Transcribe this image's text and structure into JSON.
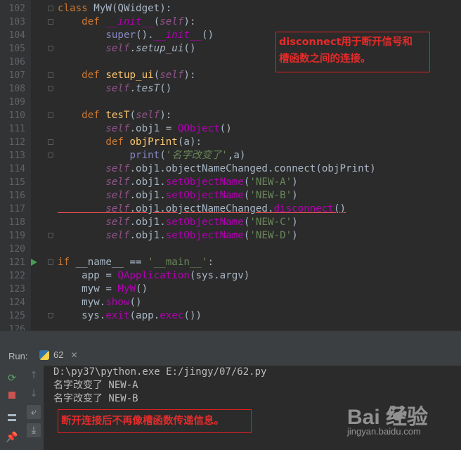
{
  "editor": {
    "lines": [
      {
        "n": "102",
        "tokens": [
          [
            "kw",
            "class "
          ],
          [
            "cls",
            "MyW"
          ],
          [
            "",
            "("
          ],
          [
            "cls",
            "QWidget"
          ],
          [
            "",
            "):"
          ]
        ]
      },
      {
        "n": "103",
        "tokens": [
          [
            "",
            "    "
          ],
          [
            "kw",
            "def "
          ],
          [
            "dund",
            "__init__"
          ],
          [
            "",
            "("
          ],
          [
            "self",
            "self"
          ],
          [
            "",
            "):"
          ]
        ]
      },
      {
        "n": "104",
        "tokens": [
          [
            "",
            "        "
          ],
          [
            "builtin",
            "super"
          ],
          [
            "",
            "()."
          ],
          [
            "dund",
            "__init__"
          ],
          [
            "",
            "()"
          ]
        ]
      },
      {
        "n": "105",
        "tokens": [
          [
            "",
            "        "
          ],
          [
            "self",
            "self"
          ],
          [
            "",
            "."
          ],
          [
            "it",
            "setup_ui"
          ],
          [
            "",
            "()"
          ]
        ]
      },
      {
        "n": "106",
        "tokens": []
      },
      {
        "n": "107",
        "tokens": [
          [
            "",
            "    "
          ],
          [
            "kw",
            "def "
          ],
          [
            "fn",
            "setup_ui"
          ],
          [
            "",
            "("
          ],
          [
            "self",
            "self"
          ],
          [
            "",
            "):"
          ]
        ]
      },
      {
        "n": "108",
        "tokens": [
          [
            "",
            "        "
          ],
          [
            "self",
            "self"
          ],
          [
            "",
            "."
          ],
          [
            "it",
            "tesT"
          ],
          [
            "",
            "()"
          ]
        ]
      },
      {
        "n": "109",
        "tokens": []
      },
      {
        "n": "110",
        "tokens": [
          [
            "",
            "    "
          ],
          [
            "kw",
            "def "
          ],
          [
            "fn",
            "tesT"
          ],
          [
            "",
            "("
          ],
          [
            "self",
            "self"
          ],
          [
            "",
            "):"
          ]
        ]
      },
      {
        "n": "111",
        "tokens": [
          [
            "",
            "        "
          ],
          [
            "self",
            "self"
          ],
          [
            "",
            ".obj1 = "
          ],
          [
            "mag",
            "QObject"
          ],
          [
            "",
            "()"
          ]
        ]
      },
      {
        "n": "112",
        "tokens": [
          [
            "",
            "        "
          ],
          [
            "kw",
            "def "
          ],
          [
            "fn",
            "objPrint"
          ],
          [
            "",
            "(a):"
          ]
        ]
      },
      {
        "n": "113",
        "tokens": [
          [
            "",
            "            "
          ],
          [
            "builtin",
            "print"
          ],
          [
            "",
            "("
          ],
          [
            "strI",
            "'名字改变了'"
          ],
          [
            "",
            ",a)"
          ]
        ]
      },
      {
        "n": "114",
        "tokens": [
          [
            "",
            "        "
          ],
          [
            "self",
            "self"
          ],
          [
            "",
            ".obj1.objectNameChanged."
          ],
          [
            "meth",
            "connect"
          ],
          [
            "",
            "(objPrint)"
          ]
        ]
      },
      {
        "n": "115",
        "tokens": [
          [
            "",
            "        "
          ],
          [
            "self",
            "self"
          ],
          [
            "",
            ".obj1."
          ],
          [
            "mag",
            "setObjectName"
          ],
          [
            "",
            "("
          ],
          [
            "str",
            "'NEW-A'"
          ],
          [
            "",
            ")"
          ]
        ]
      },
      {
        "n": "116",
        "tokens": [
          [
            "",
            "        "
          ],
          [
            "self",
            "self"
          ],
          [
            "",
            ".obj1."
          ],
          [
            "mag",
            "setObjectName"
          ],
          [
            "",
            "("
          ],
          [
            "str",
            "'NEW-B'"
          ],
          [
            "",
            ")"
          ]
        ]
      },
      {
        "n": "117",
        "tokens": [
          [
            "",
            "        "
          ],
          [
            "self",
            "self"
          ],
          [
            "",
            ".obj1.objectNameChanged."
          ],
          [
            "mag",
            "disconnect"
          ],
          [
            "",
            "()"
          ]
        ]
      },
      {
        "n": "118",
        "tokens": [
          [
            "",
            "        "
          ],
          [
            "self",
            "self"
          ],
          [
            "",
            ".obj1."
          ],
          [
            "mag",
            "setObjectName"
          ],
          [
            "",
            "("
          ],
          [
            "str",
            "'NEW-C'"
          ],
          [
            "",
            ")"
          ]
        ]
      },
      {
        "n": "119",
        "tokens": [
          [
            "",
            "        "
          ],
          [
            "self",
            "self"
          ],
          [
            "",
            ".obj1."
          ],
          [
            "mag",
            "setObjectName"
          ],
          [
            "",
            "("
          ],
          [
            "str",
            "'NEW-D'"
          ],
          [
            "",
            ")"
          ]
        ]
      },
      {
        "n": "120",
        "tokens": []
      },
      {
        "n": "121",
        "tokens": [
          [
            "kw",
            "if "
          ],
          [
            "",
            "__name__ == "
          ],
          [
            "str",
            "'__main__'"
          ],
          [
            "",
            ":"
          ]
        ]
      },
      {
        "n": "122",
        "tokens": [
          [
            "",
            "    app = "
          ],
          [
            "mag",
            "QApplication"
          ],
          [
            "",
            "(sys.argv)"
          ]
        ]
      },
      {
        "n": "123",
        "tokens": [
          [
            "",
            "    myw = "
          ],
          [
            "mag",
            "MyW"
          ],
          [
            "",
            "()"
          ]
        ]
      },
      {
        "n": "124",
        "tokens": [
          [
            "",
            "    myw."
          ],
          [
            "mag",
            "show"
          ],
          [
            "",
            "()"
          ]
        ]
      },
      {
        "n": "125",
        "tokens": [
          [
            "",
            "    sys."
          ],
          [
            "mag",
            "exit"
          ],
          [
            "",
            "(app."
          ],
          [
            "mag",
            "exec"
          ],
          [
            "",
            "())"
          ]
        ]
      },
      {
        "n": "126",
        "tokens": []
      }
    ],
    "callout_top": "disconnect用于断开信号和\n槽函数之间的连接。"
  },
  "run_panel": {
    "label": "Run:",
    "tab_name": "62",
    "console_lines": [
      "D:\\py37\\python.exe E:/jingy/07/62.py",
      "名字改变了 NEW-A",
      "名字改变了 NEW-B"
    ],
    "callout_bottom": "断开连接后不再像槽函数传递信息。"
  },
  "watermark": {
    "brand": "Bai 经验",
    "url": "jingyan.baidu.com"
  },
  "colors": {
    "editor_bg": "#2b2b2b",
    "gutter_bg": "#313335",
    "panel_bg": "#3c3f41",
    "keyword": "#cc7832",
    "string": "#6a8759",
    "function": "#ffc66d",
    "self": "#94558d",
    "magic": "#b200b2",
    "callout_red": "#e52b2b"
  }
}
